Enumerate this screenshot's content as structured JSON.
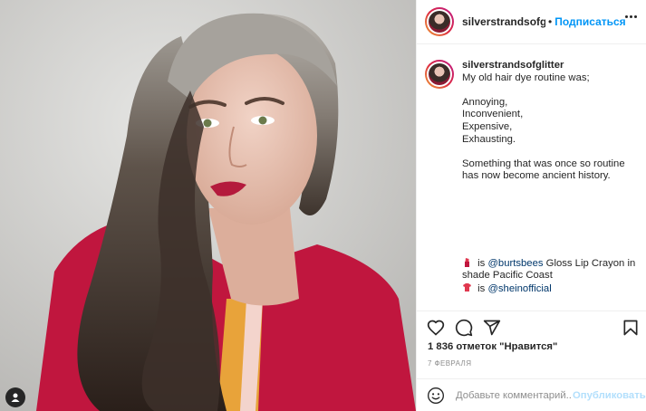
{
  "post": {
    "username": "silverstrandsofglitter",
    "header_username": "silverstrandsofglittе",
    "dot": "•",
    "follow_label": "Подписаться",
    "caption_lines": [
      "My old hair dye routine was;",
      "",
      "Annoying,",
      "Inconvenient,",
      "Expensive,",
      "Exhausting.",
      "",
      "Something that was once so routine",
      "has now become ancient history."
    ],
    "credit_1_prefix": " is ",
    "credit_1_link": "@burtsbees",
    "credit_1_suffix": " Gloss Lip Crayon in",
    "credit_1_line2": "shade Pacific Coast",
    "credit_2_prefix": " is ",
    "credit_2_link": "@sheinofficial",
    "likes": "1 836 отметок \"Нравится\"",
    "date": "7 февраля"
  },
  "comment": {
    "placeholder": "Добавьте комментарий...",
    "publish_label": "Опубликовать"
  },
  "icons": {
    "like": "heart-icon",
    "comment": "comment-icon",
    "share": "share-icon",
    "save": "bookmark-icon",
    "more": "more-dots-icon",
    "emoji": "emoji-icon",
    "user": "user-icon"
  },
  "colors": {
    "accent": "#0095f6",
    "publish_disabled": "#b2dffc",
    "shirt": "#c0163e",
    "lips": "#b41a3c"
  }
}
